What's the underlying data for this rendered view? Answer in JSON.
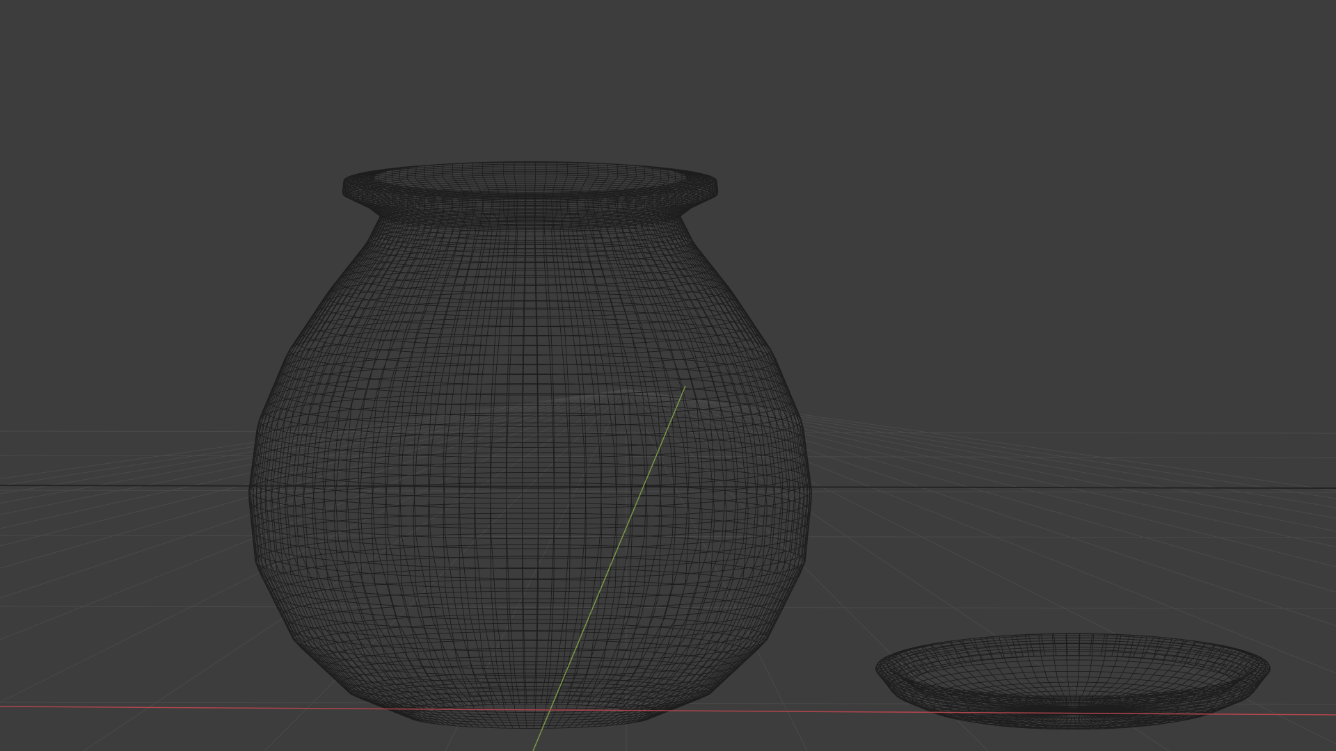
{
  "viewport": {
    "mode": "wireframe",
    "background_color": "#3d3d3d",
    "grid_color": "#4a4a4a",
    "horizon_color": "#242424",
    "wire_color": "#1d1d1d",
    "x_axis_color": "#b0454d",
    "y_axis_color": "#7a9a46"
  },
  "objects": [
    {
      "label": "pot",
      "type": "wireframe-mesh"
    },
    {
      "label": "dish",
      "type": "wireframe-mesh"
    }
  ]
}
